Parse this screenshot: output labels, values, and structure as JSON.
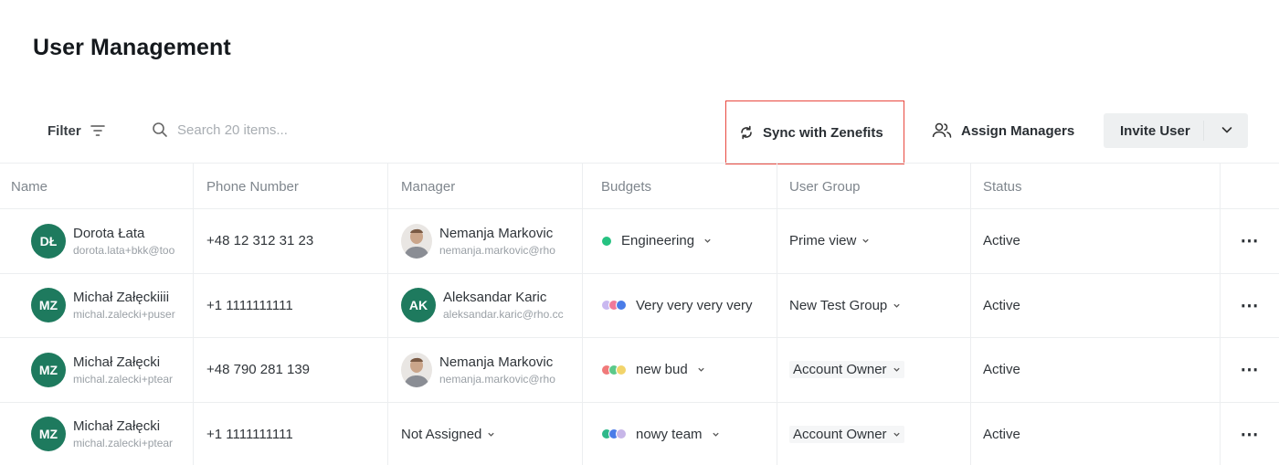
{
  "page": {
    "title": "User Management"
  },
  "toolbar": {
    "filter_label": "Filter",
    "search_placeholder": "Search 20 items...",
    "sync_label": "Sync with Zenefits",
    "assign_label": "Assign Managers",
    "invite_label": "Invite User"
  },
  "table": {
    "columns": [
      "Name",
      "Phone Number",
      "Manager",
      "Budgets",
      "User Group",
      "Status"
    ],
    "rows": [
      {
        "initials": "DŁ",
        "name": "Dorota Łata",
        "email": "dorota.lata+bkk@too",
        "phone": "+48 12 312 31 23",
        "manager_name": "Nemanja Markovic",
        "manager_email": "nemanja.markovic@rho",
        "budget": "Engineering",
        "budget_colors": [
          "#26c281"
        ],
        "group": "Prime view",
        "status": "Active"
      },
      {
        "initials": "MZ",
        "name": "Michał Załęckiiii",
        "email": "michal.zalecki+puser",
        "phone": "+1 1111111111",
        "manager_initials": "AK",
        "manager_name": "Aleksandar Karic",
        "manager_email": "aleksandar.karic@rho.cc",
        "budget": "Very very very very",
        "budget_colors": [
          "#c9b8f0",
          "#f07a9a",
          "#4a7ce8"
        ],
        "group": "New Test Group",
        "status": "Active"
      },
      {
        "initials": "MZ",
        "name": "Michał Załęcki",
        "email": "michal.zalecki+ptear",
        "phone": "+48 790 281 139",
        "manager_name": "Nemanja Markovic",
        "manager_email": "nemanja.markovic@rho",
        "budget": "new bud",
        "budget_colors": [
          "#f07a7a",
          "#5bc98a",
          "#f2d46b"
        ],
        "group": "Account Owner",
        "status": "Active"
      },
      {
        "initials": "MZ",
        "name": "Michał Załęcki",
        "email": "michal.zalecki+ptear",
        "phone": "+1 1111111111",
        "manager_label": "Not Assigned",
        "budget": "nowy team",
        "budget_colors": [
          "#2fb88a",
          "#4a7ce8",
          "#c7b6e8"
        ],
        "group": "Account Owner",
        "status": "Active"
      }
    ]
  },
  "colors": {
    "avatar": "#1e7a5e",
    "highlight_border": "#e8483f",
    "invite_bg": "#eef0f1"
  },
  "icons": [
    "filter-icon",
    "search-icon",
    "sync-icon",
    "users-icon",
    "chevron-down-icon",
    "more-icon"
  ]
}
